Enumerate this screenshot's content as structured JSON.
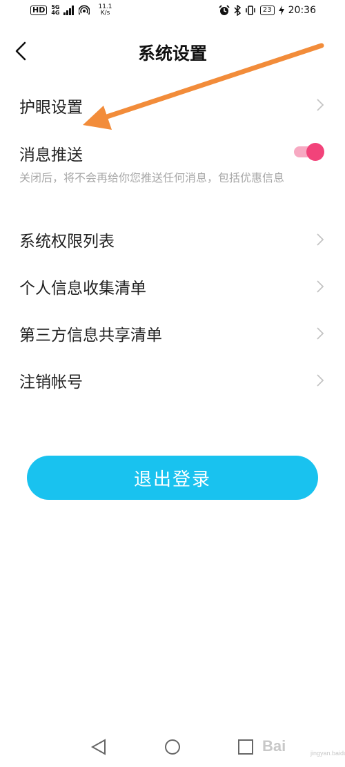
{
  "status_bar": {
    "hd": "HD",
    "network_type_top": "5G",
    "network_type_bottom": "4G",
    "speed_value": "11.1",
    "speed_unit": "K/s",
    "battery": "23",
    "time": "20:36"
  },
  "header": {
    "title": "系统设置",
    "back_icon": "chevron-left-icon"
  },
  "settings": {
    "eye_protection": {
      "label": "护眼设置"
    },
    "push_notifications": {
      "label": "消息推送",
      "description": "关闭后，将不会再给你您推送任何消息，包括优惠信息",
      "enabled": true
    },
    "permission_list": {
      "label": "系统权限列表"
    },
    "personal_info_list": {
      "label": "个人信息收集清单"
    },
    "third_party_list": {
      "label": "第三方信息共享清单"
    },
    "cancel_account": {
      "label": "注销帐号"
    }
  },
  "logout": {
    "label": "退出登录"
  },
  "colors": {
    "accent": "#19c2ef",
    "toggle_knob": "#f2437a",
    "toggle_track": "#f7a9c2",
    "annotation_arrow": "#f28c3a",
    "chevron": "#c4c4c4"
  },
  "nav_bar": {
    "back_icon": "triangle-back-icon",
    "home_icon": "circle-home-icon",
    "recents_icon": "square-recents-icon"
  },
  "watermark": {
    "text": "Bai",
    "sub": "jingyan.baidu.com"
  }
}
